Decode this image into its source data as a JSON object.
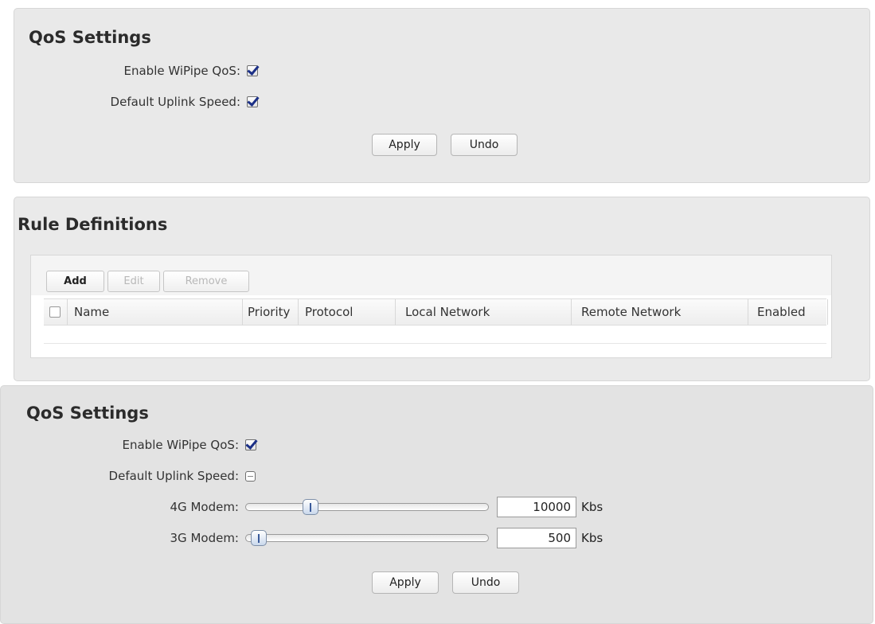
{
  "qos_panel_1": {
    "title": "QoS Settings",
    "enable_label": "Enable WiPipe QoS:",
    "enable_checked": true,
    "uplink_label": "Default Uplink Speed:",
    "uplink_checked": true,
    "apply_label": "Apply",
    "undo_label": "Undo"
  },
  "rules_panel": {
    "title": "Rule Definitions",
    "toolbar": {
      "add_label": "Add",
      "edit_label": "Edit",
      "remove_label": "Remove"
    },
    "columns": [
      "Name",
      "Priority",
      "Protocol",
      "Local Network",
      "Remote Network",
      "Enabled"
    ]
  },
  "qos_panel_2": {
    "title": "QoS Settings",
    "enable_label": "Enable WiPipe QoS:",
    "enable_checked": true,
    "uplink_label": "Default Uplink Speed:",
    "uplink_checked": false,
    "modem_4g": {
      "label": "4G Modem:",
      "value": "10000",
      "unit": "Kbs",
      "slider_fraction": 0.25
    },
    "modem_3g": {
      "label": "3G Modem:",
      "value": "500",
      "unit": "Kbs",
      "slider_fraction": 0.02
    },
    "apply_label": "Apply",
    "undo_label": "Undo"
  }
}
